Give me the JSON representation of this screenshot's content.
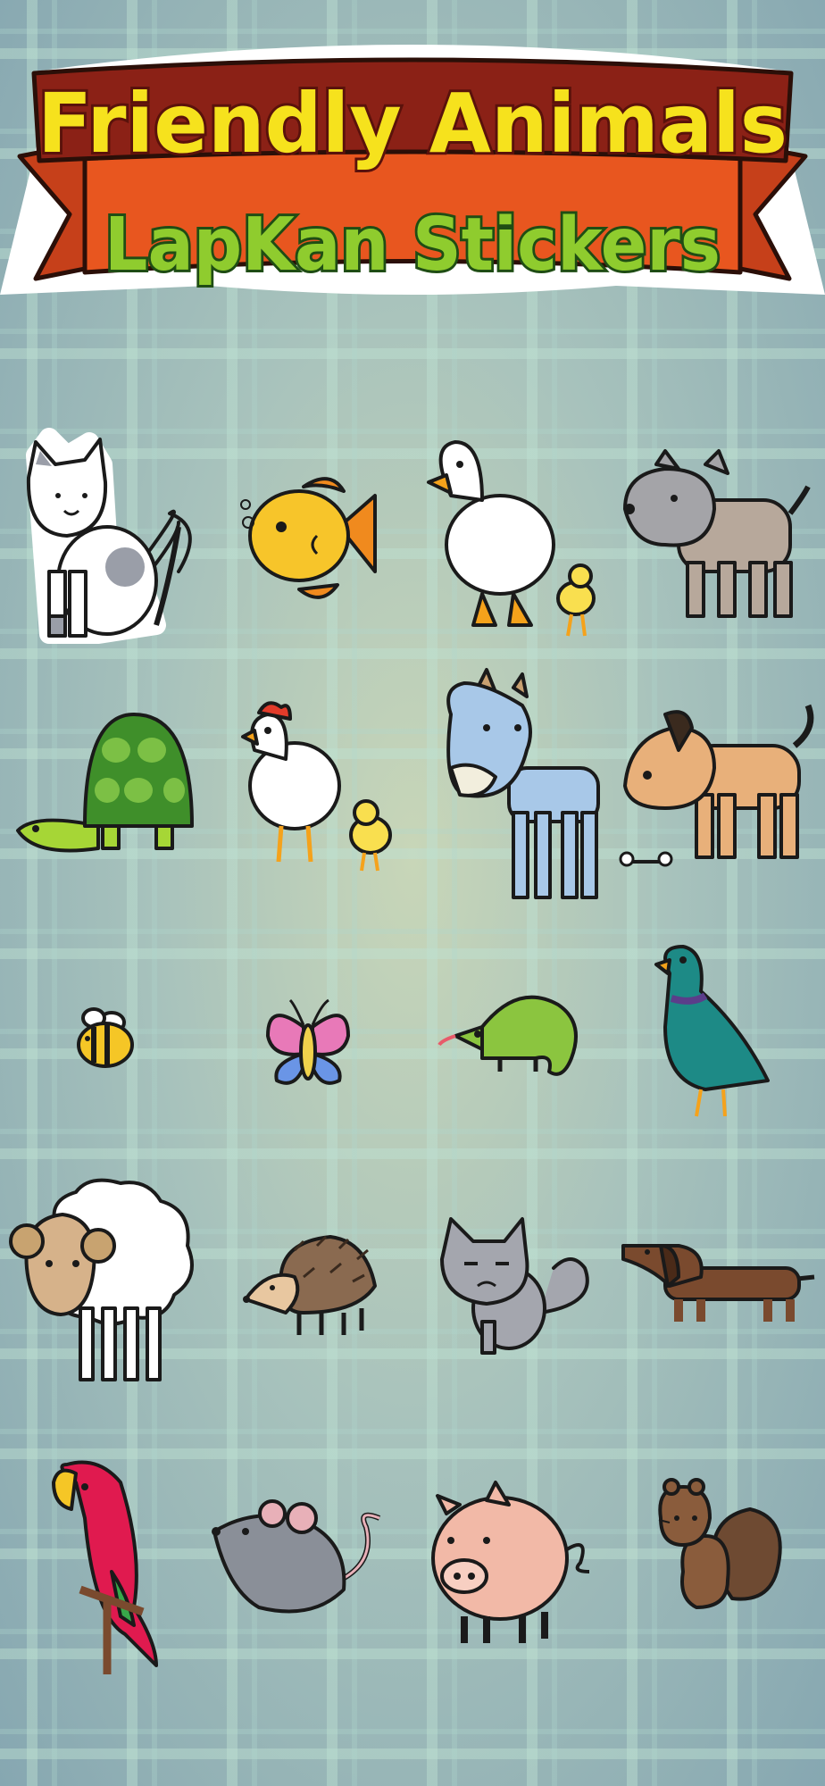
{
  "header": {
    "title": "Friendly Animals",
    "subtitle": "LapKan Stickers"
  },
  "colors": {
    "title_fill": "#f6e21d",
    "title_outline": "#7a1a12",
    "subtitle_fill": "#8fcc2e",
    "subtitle_outline": "#1f4d14",
    "ribbon": "#e8561f",
    "ribbon_dark": "#b93a15"
  },
  "stickers": [
    {
      "icon": "cat-icon"
    },
    {
      "icon": "fish-icon"
    },
    {
      "icon": "duck-icon"
    },
    {
      "icon": "terrier-dog-icon"
    },
    {
      "icon": "turtle-icon"
    },
    {
      "icon": "hen-icon"
    },
    {
      "icon": "goat-icon"
    },
    {
      "icon": "dog-with-bone-icon"
    },
    {
      "icon": "bee-icon"
    },
    {
      "icon": "butterfly-icon"
    },
    {
      "icon": "chameleon-icon"
    },
    {
      "icon": "pigeon-icon"
    },
    {
      "icon": "sheep-icon"
    },
    {
      "icon": "hedgehog-icon"
    },
    {
      "icon": "grumpy-cat-icon"
    },
    {
      "icon": "dachshund-icon"
    },
    {
      "icon": "parrot-icon"
    },
    {
      "icon": "mouse-icon"
    },
    {
      "icon": "pig-icon"
    },
    {
      "icon": "squirrel-icon"
    }
  ]
}
